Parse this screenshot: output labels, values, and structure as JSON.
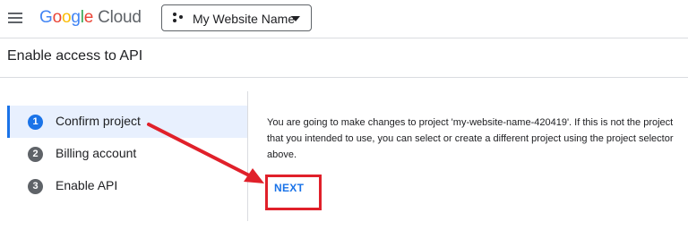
{
  "header": {
    "menu_icon": "hamburger-menu-icon",
    "logo": {
      "brand_letters": [
        {
          "char": "G",
          "color": "#4285F4"
        },
        {
          "char": "o",
          "color": "#EA4335"
        },
        {
          "char": "o",
          "color": "#FBBC05"
        },
        {
          "char": "g",
          "color": "#4285F4"
        },
        {
          "char": "l",
          "color": "#34A853"
        },
        {
          "char": "e",
          "color": "#EA4335"
        }
      ],
      "product": "Cloud"
    },
    "project_selector": {
      "label": "My Website Name",
      "icon": "project-dots-icon"
    }
  },
  "page": {
    "title": "Enable access to API"
  },
  "steps": [
    {
      "number": "1",
      "label": "Confirm project",
      "active": true
    },
    {
      "number": "2",
      "label": "Billing account",
      "active": false
    },
    {
      "number": "3",
      "label": "Enable API",
      "active": false
    }
  ],
  "content": {
    "message": "You are going to make changes to project 'my-website-name-420419'. If this is not the project that you intended to use, you can select or create a different project using the project selector above.",
    "next_label": "NEXT"
  },
  "colors": {
    "accent": "#1a73e8",
    "annotation": "#e0202a",
    "active_step_bg": "#e8f0fe"
  }
}
